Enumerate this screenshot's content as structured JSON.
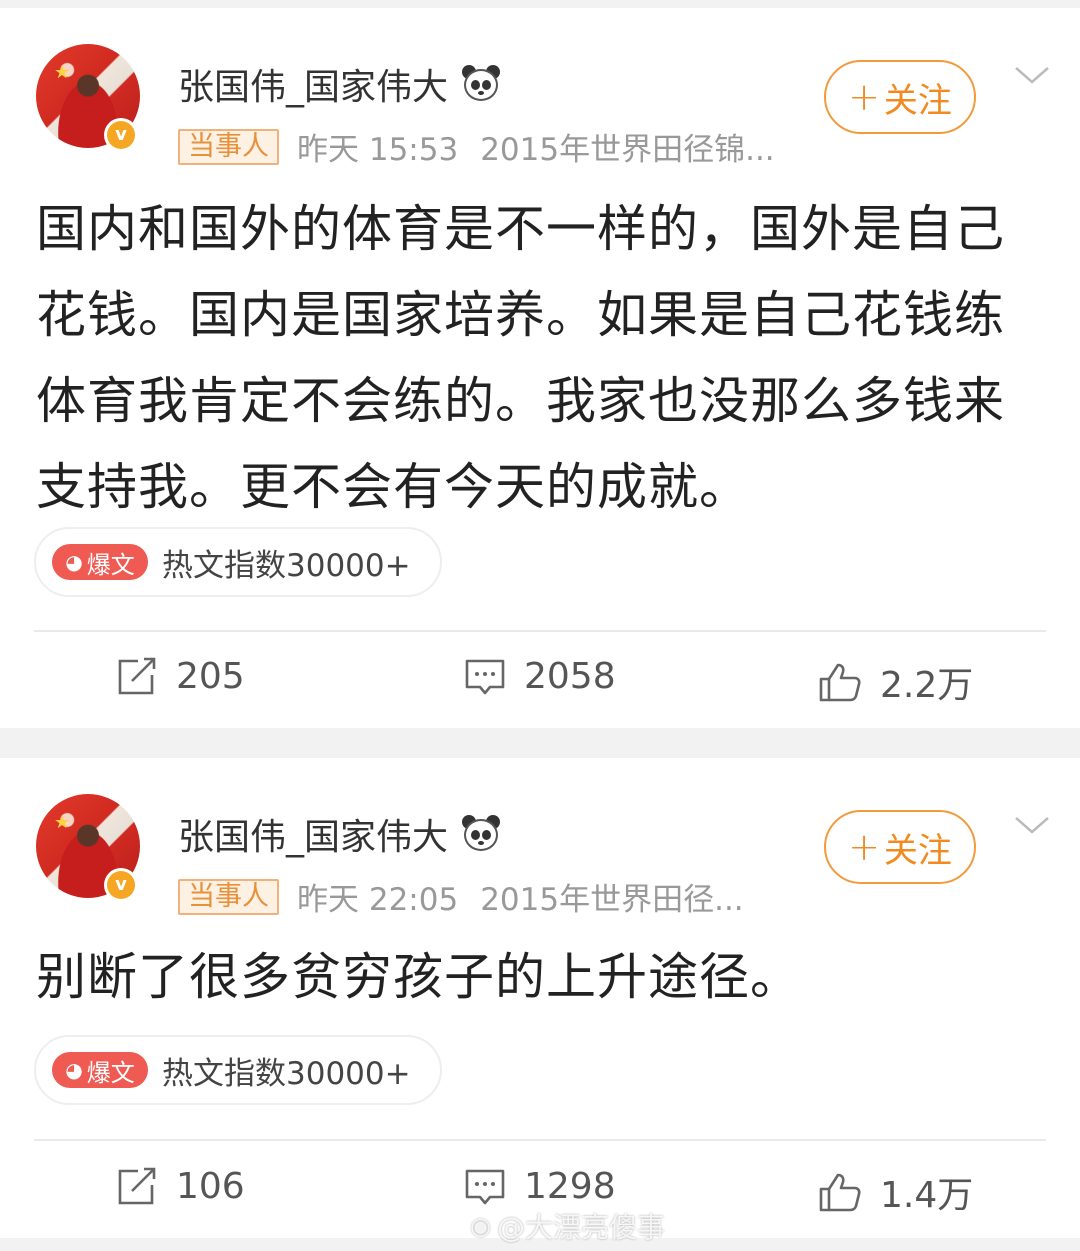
{
  "posts": [
    {
      "username": "张国伟_国家伟大",
      "tag": "当事人",
      "time": "昨天 15:53",
      "source": "2015年世界田径锦...",
      "follow_label": "关注",
      "text": "国内和国外的体育是不一样的，国外是自己花钱。国内是国家培养。如果是自己花钱练体育我肯定不会练的。我家也没那么多钱来支持我。更不会有今天的成就。",
      "hot_badge": "爆文",
      "hot_text": "热文指数30000+",
      "reposts": "205",
      "comments": "2058",
      "likes": "2.2万"
    },
    {
      "username": "张国伟_国家伟大",
      "tag": "当事人",
      "time": "昨天 22:05",
      "source": "2015年世界田径...",
      "follow_label": "关注",
      "text": "别断了很多贫穷孩子的上升途径。",
      "hot_badge": "爆文",
      "hot_text": "热文指数30000+",
      "reposts": "106",
      "comments": "1298",
      "likes": "1.4万"
    }
  ],
  "watermark": "@大漂亮傻事",
  "colors": {
    "accent_orange": "#f08a21",
    "hot_red": "#ef5a52",
    "verified_gold": "#f5a623"
  }
}
